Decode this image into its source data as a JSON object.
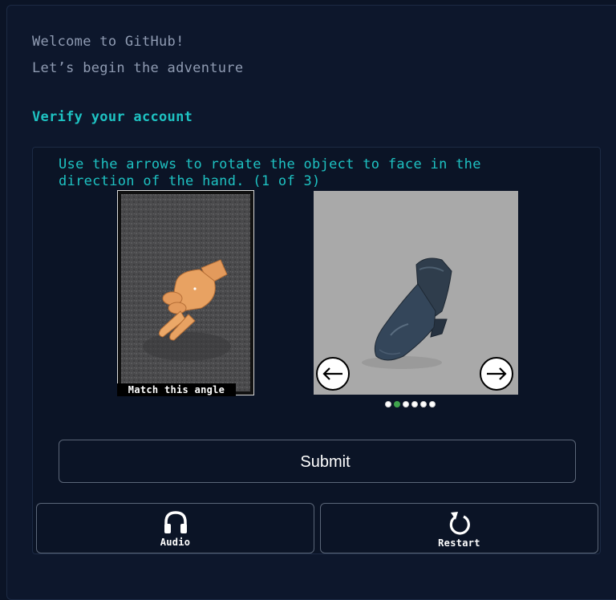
{
  "header": {
    "welcome": "Welcome to GitHub!",
    "subtitle": "Let’s begin the adventure"
  },
  "verification": {
    "heading": "Verify your account",
    "instructions": "Use the arrows to rotate the object to face in the direction of the hand. (1 of 3)",
    "reference_caption": "Match this angle",
    "reference_icon": "pointing-hand-icon",
    "object_icon": "boot-icon",
    "arrow_left_icon": "arrow-left-icon",
    "arrow_right_icon": "arrow-right-icon",
    "position_dots": {
      "total": 6,
      "active_index": 1
    },
    "accent_color": "#1ec2c2",
    "active_dot_color": "#3fa34d"
  },
  "actions": {
    "submit_label": "Submit",
    "audio_label": "Audio",
    "audio_icon": "headphones-icon",
    "restart_label": "Restart",
    "restart_icon": "restart-icon"
  }
}
